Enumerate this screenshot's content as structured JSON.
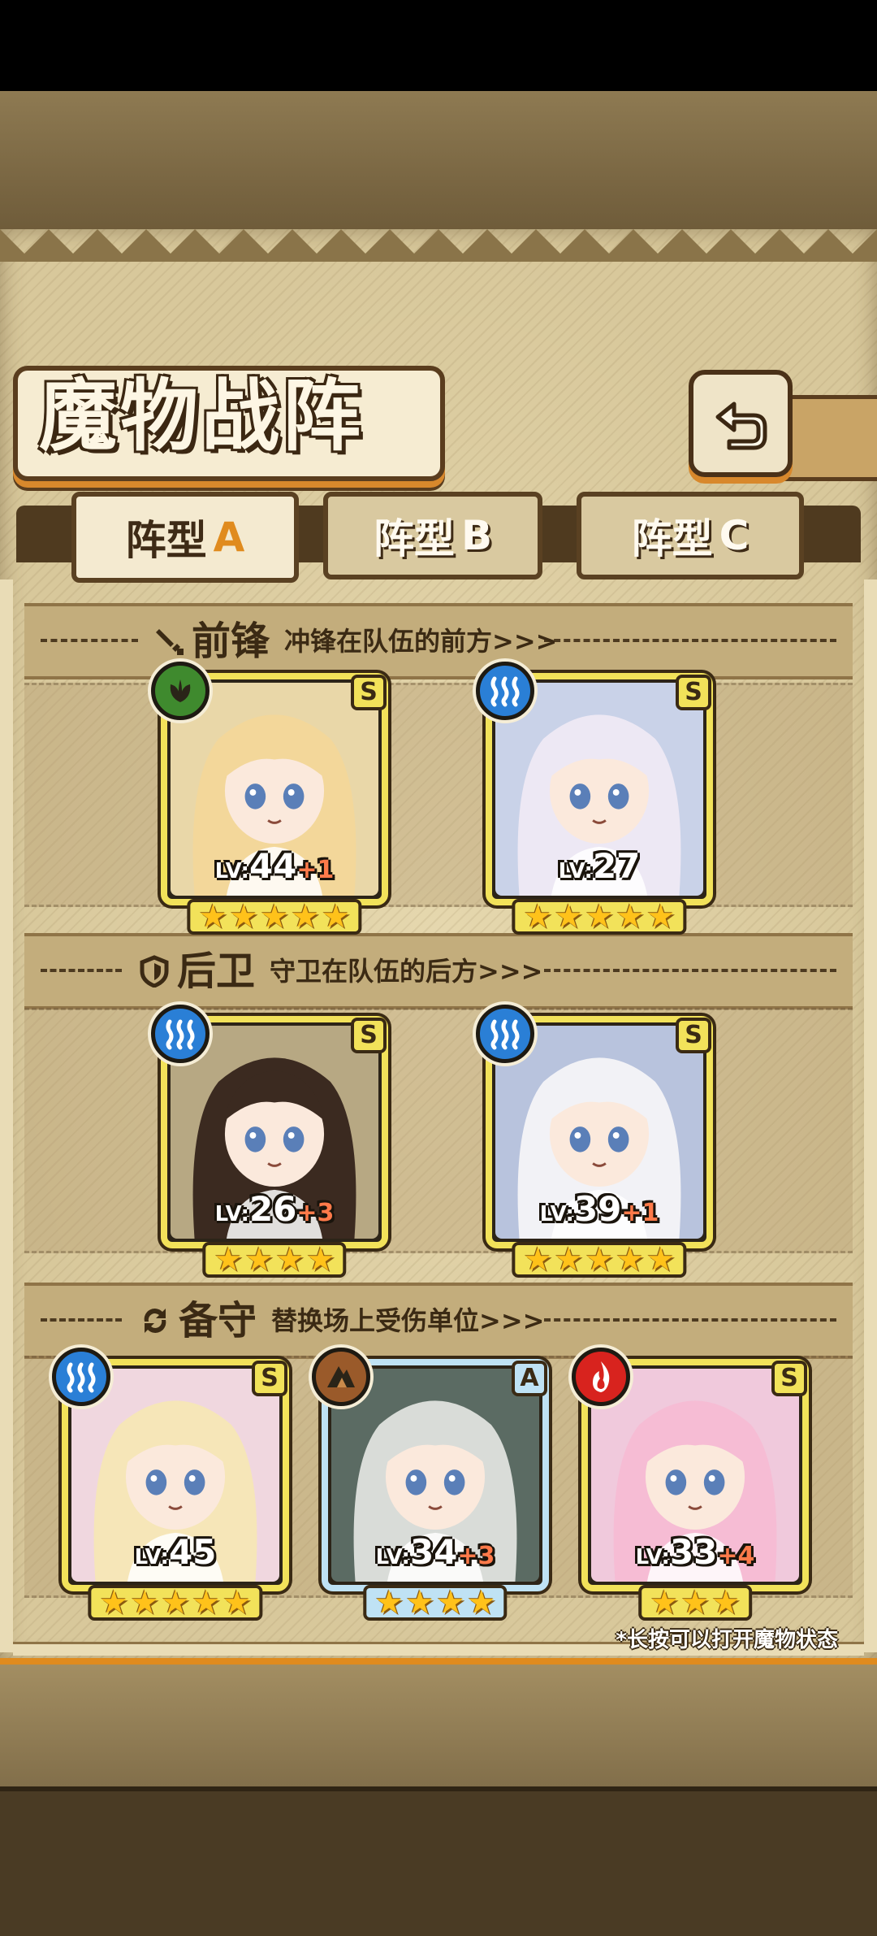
{
  "screen": {
    "title": "魔物战阵",
    "back_icon": "return-arrow-icon"
  },
  "tabs": [
    {
      "label": "阵型",
      "letter": "A",
      "active": true
    },
    {
      "label": "阵型",
      "letter": "B",
      "active": false
    },
    {
      "label": "阵型",
      "letter": "C",
      "active": false
    }
  ],
  "sections": {
    "front": {
      "title": "前锋",
      "desc": "冲锋在队伍的前方>>>",
      "icon": "sword-icon"
    },
    "rear": {
      "title": "后卫",
      "desc": "守卫在队伍的后方>>>",
      "icon": "shield-icon"
    },
    "reserve": {
      "title": "备守",
      "desc": "替换场上受伤单位>>>",
      "icon": "swap-icon"
    }
  },
  "units": {
    "front": [
      {
        "rank": "S",
        "element": "nature",
        "level_tag": "LV:",
        "level": "44",
        "plus": "+1",
        "stars": 5,
        "hair": "#f3d79a",
        "bg": "#e9d7a8"
      },
      {
        "rank": "S",
        "element": "water",
        "level_tag": "LV:",
        "level": "27",
        "plus": "",
        "stars": 5,
        "hair": "#ede8f4",
        "bg": "#c9d2e8"
      }
    ],
    "rear": [
      {
        "rank": "S",
        "element": "water",
        "level_tag": "LV:",
        "level": "26",
        "plus": "+3",
        "stars": 4,
        "hair": "#3b2a20",
        "bg": "#b7a883"
      },
      {
        "rank": "S",
        "element": "water",
        "level_tag": "LV:",
        "level": "39",
        "plus": "+1",
        "stars": 5,
        "hair": "#f2f2f6",
        "bg": "#b8c3dd"
      }
    ],
    "reserve": [
      {
        "rank": "S",
        "element": "water",
        "level_tag": "LV:",
        "level": "45",
        "plus": "",
        "stars": 5,
        "hair": "#f6e6b8",
        "bg": "#f0d7df"
      },
      {
        "rank": "A",
        "element": "earth",
        "level_tag": "LV:",
        "level": "34",
        "plus": "+3",
        "stars": 4,
        "hair": "#d9dcd8",
        "bg": "#5b6b63"
      },
      {
        "rank": "S",
        "element": "fire",
        "level_tag": "LV:",
        "level": "33",
        "plus": "+4",
        "stars": 3,
        "hair": "#f6bcd4",
        "bg": "#f0c9dc"
      }
    ]
  },
  "footer": {
    "hint": "*长按可以打开魔物状态"
  }
}
